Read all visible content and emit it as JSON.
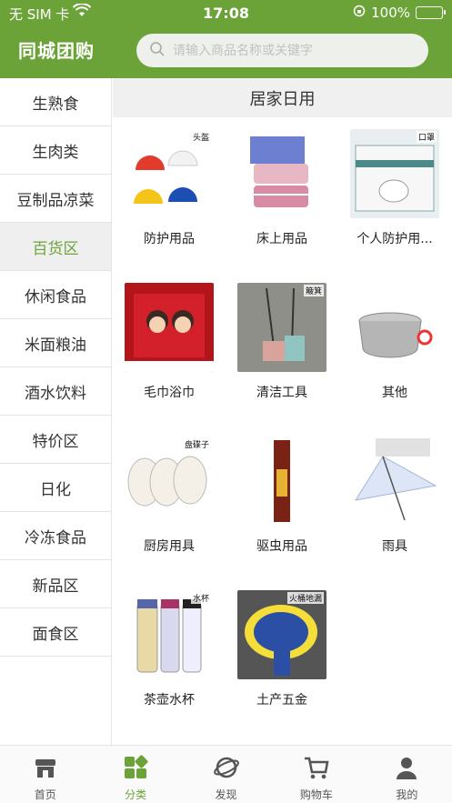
{
  "status": {
    "carrier": "无 SIM 卡",
    "time": "17:08",
    "battery": "100%",
    "battery_level": 1.0
  },
  "header": {
    "brand": "同城团购",
    "search_placeholder": "请输入商品名称或关键字"
  },
  "sidebar": {
    "items": [
      {
        "label": "生熟食"
      },
      {
        "label": "生肉类"
      },
      {
        "label": "豆制品凉菜"
      },
      {
        "label": "百货区",
        "active": true
      },
      {
        "label": "休闲食品"
      },
      {
        "label": "米面粮油"
      },
      {
        "label": "酒水饮料"
      },
      {
        "label": "特价区"
      },
      {
        "label": "日化"
      },
      {
        "label": "冷冻食品"
      },
      {
        "label": "新品区"
      },
      {
        "label": "面食区"
      }
    ]
  },
  "main": {
    "category_title": "居家日用",
    "products": [
      {
        "label": "防护用品",
        "tag": "头盔"
      },
      {
        "label": "床上用品",
        "tag": ""
      },
      {
        "label": "个人防护用...",
        "tag": "口罩"
      },
      {
        "label": "毛巾浴巾",
        "tag": ""
      },
      {
        "label": "清洁工具",
        "tag": "簸箕"
      },
      {
        "label": "其他",
        "tag": ""
      },
      {
        "label": "厨房用具",
        "tag": "盘碟子"
      },
      {
        "label": "驱虫用品",
        "tag": ""
      },
      {
        "label": "雨具",
        "tag": ""
      },
      {
        "label": "茶壶水杯",
        "tag": "水杯"
      },
      {
        "label": "土产五金",
        "tag": "火桶地漏"
      }
    ]
  },
  "tabbar": {
    "tabs": [
      {
        "label": "首页",
        "icon": "store-icon"
      },
      {
        "label": "分类",
        "icon": "category-icon",
        "active": true
      },
      {
        "label": "发现",
        "icon": "planet-icon"
      },
      {
        "label": "购物车",
        "icon": "cart-icon"
      },
      {
        "label": "我的",
        "icon": "user-icon"
      }
    ]
  },
  "colors": {
    "brand": "#6ba338",
    "active_text": "#6ba338",
    "sidebar_active_bg": "#efefef"
  }
}
